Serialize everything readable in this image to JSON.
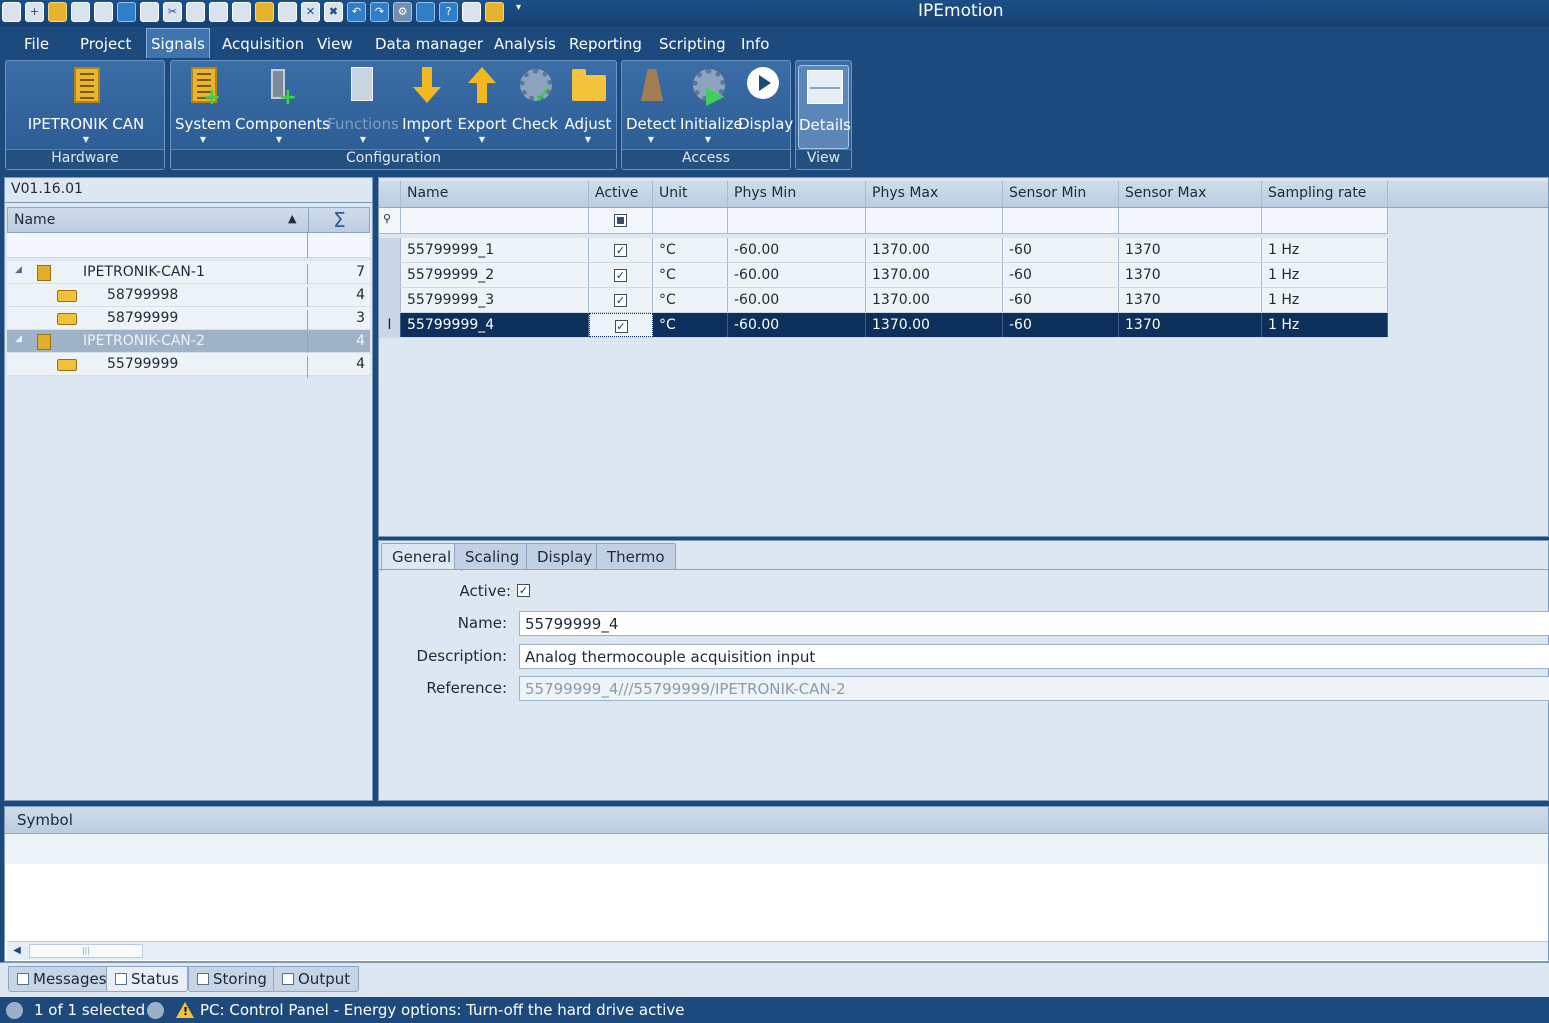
{
  "app": {
    "title": "IPEmotion"
  },
  "quick_access": [
    "new-icon",
    "add-icon",
    "open-folder-icon",
    "save-icon",
    "save-as-icon",
    "auto-icon",
    "print-icon",
    "cut-icon",
    "copy-icon",
    "paste-icon",
    "paste-special-icon",
    "export-icon",
    "import-icon",
    "delete-icon",
    "delete-all-icon",
    "undo-icon",
    "redo-icon",
    "settings-icon",
    "tools-icon",
    "help-icon",
    "picture-icon",
    "hand-icon"
  ],
  "menu": [
    "File",
    "Project",
    "Signals",
    "Acquisition",
    "View",
    "Data manager",
    "Analysis",
    "Reporting",
    "Scripting",
    "Info"
  ],
  "menu_active": "Signals",
  "ribbon": {
    "hardware": {
      "label": "Hardware",
      "button": "IPETRONIK CAN"
    },
    "configuration": {
      "label": "Configuration",
      "buttons": [
        "System",
        "Components",
        "Functions",
        "Import",
        "Export",
        "Check",
        "Adjust"
      ]
    },
    "access": {
      "label": "Access",
      "buttons": [
        "Detect",
        "Initialize",
        "Display"
      ]
    },
    "view": {
      "label": "View",
      "button": "Details"
    }
  },
  "tree": {
    "version": "V01.16.01",
    "header": "Name",
    "sum_icon": "Σ",
    "rows": [
      {
        "label": "IPETRONIK-CAN-1",
        "count": "7",
        "level": 0,
        "type": "system"
      },
      {
        "label": "58799998",
        "count": "4",
        "level": 1,
        "type": "module"
      },
      {
        "label": "58799999",
        "count": "3",
        "level": 1,
        "type": "module"
      },
      {
        "label": "IPETRONIK-CAN-2",
        "count": "4",
        "level": 0,
        "type": "system",
        "selected": true
      },
      {
        "label": "55799999",
        "count": "4",
        "level": 1,
        "type": "module"
      }
    ]
  },
  "grid": {
    "columns": [
      "Name",
      "Active",
      "Unit",
      "Phys Min",
      "Phys Max",
      "Sensor Min",
      "Sensor Max",
      "Sampling rate"
    ],
    "rows": [
      {
        "name": "55799999_1",
        "active": "✓",
        "unit": "°C",
        "phys_min": "-60.00",
        "phys_max": "1370.00",
        "sensor_min": "-60",
        "sensor_max": "1370",
        "rate": "1 Hz"
      },
      {
        "name": "55799999_2",
        "active": "✓",
        "unit": "°C",
        "phys_min": "-60.00",
        "phys_max": "1370.00",
        "sensor_min": "-60",
        "sensor_max": "1370",
        "rate": "1 Hz"
      },
      {
        "name": "55799999_3",
        "active": "✓",
        "unit": "°C",
        "phys_min": "-60.00",
        "phys_max": "1370.00",
        "sensor_min": "-60",
        "sensor_max": "1370",
        "rate": "1 Hz"
      },
      {
        "name": "55799999_4",
        "active": "✓",
        "unit": "°C",
        "phys_min": "-60.00",
        "phys_max": "1370.00",
        "sensor_min": "-60",
        "sensor_max": "1370",
        "rate": "1 Hz",
        "selected": true
      }
    ],
    "cursor_glyph": "I"
  },
  "details": {
    "tabs": [
      "General",
      "Scaling",
      "Display",
      "Thermo"
    ],
    "active_tab": "General",
    "labels": {
      "active": "Active:",
      "name": "Name:",
      "description": "Description:",
      "reference": "Reference:"
    },
    "active_check": "✓",
    "name": "55799999_4",
    "description": "Analog thermocouple acquisition input",
    "reference": "55799999_4///55799999/IPETRONIK-CAN-2"
  },
  "symbol": {
    "header": "Symbol",
    "scroll_left": "◀",
    "scroll_grip": "|||"
  },
  "bottom_tabs": [
    "Messages",
    "Status",
    "Storing",
    "Output"
  ],
  "bottom_active": "Status",
  "status": {
    "selection": "1 of 1 selected",
    "message": "PC: Control Panel - Energy options: Turn-off the hard drive active"
  }
}
